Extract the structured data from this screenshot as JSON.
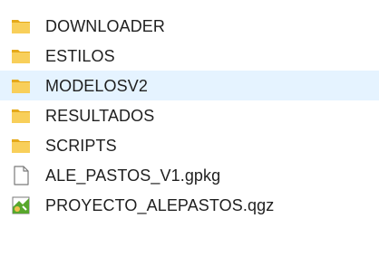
{
  "items": [
    {
      "name": "DOWNLOADER",
      "type": "folder",
      "icon": "folder-icon"
    },
    {
      "name": "ESTILOS",
      "type": "folder",
      "icon": "folder-icon"
    },
    {
      "name": "MODELOSV2",
      "type": "folder",
      "icon": "folder-icon",
      "selected": true
    },
    {
      "name": "RESULTADOS",
      "type": "folder",
      "icon": "folder-icon"
    },
    {
      "name": "SCRIPTS",
      "type": "folder",
      "icon": "folder-icon"
    },
    {
      "name": "ALE_PASTOS_V1.gpkg",
      "type": "file",
      "icon": "blank-file-icon"
    },
    {
      "name": "PROYECTO_ALEPASTOS.qgz",
      "type": "qgis-project",
      "icon": "qgis-project-icon"
    }
  ],
  "colors": {
    "folder": "#f5c84c",
    "folder_light": "#ffe08a",
    "selection": "#e5f3ff",
    "text": "#1f1f1f",
    "qgis_green": "#58a72d"
  }
}
